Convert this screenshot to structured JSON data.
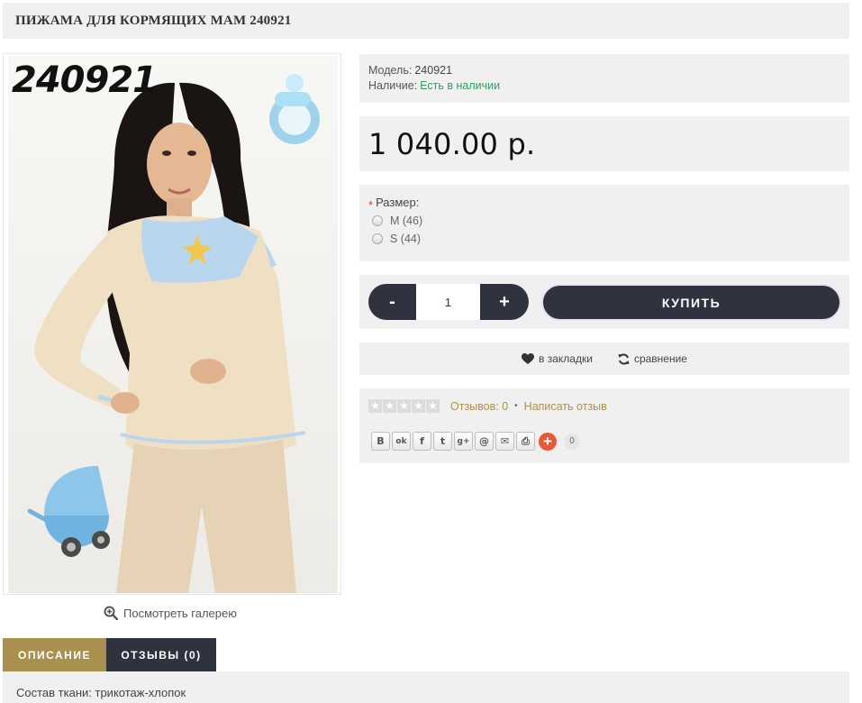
{
  "product": {
    "title": "ПИЖАМА ДЛЯ КОРМЯЩИХ МАМ 240921",
    "photo_code": "240921",
    "gallery_label": "Посмотреть галерею"
  },
  "info": {
    "model_label": "Модель:",
    "model_value": "240921",
    "availability_label": "Наличие:",
    "availability_value": "Есть в наличии"
  },
  "price": "1 040.00 р.",
  "options": {
    "required_mark": "*",
    "size_label": "Размер:",
    "sizes": [
      {
        "label": "M (46)",
        "selected": false
      },
      {
        "label": "S (44)",
        "selected": false
      }
    ]
  },
  "purchase": {
    "minus_label": "-",
    "plus_label": "+",
    "quantity": "1",
    "buy_label": "КУПИТЬ"
  },
  "links": {
    "wishlist_label": "в закладки",
    "compare_label": "сравнение"
  },
  "reviews": {
    "stars_filled": 0,
    "stars_total": 5,
    "count_label": "Отзывов: 0",
    "separator": "•",
    "write_label": "Написать отзыв"
  },
  "share": {
    "buttons": [
      {
        "name": "vk-icon",
        "glyph": "В"
      },
      {
        "name": "odnoklassniki-icon",
        "glyph": "ok"
      },
      {
        "name": "facebook-icon",
        "glyph": "f"
      },
      {
        "name": "twitter-icon",
        "glyph": "t"
      },
      {
        "name": "google-plus-icon",
        "glyph": "g+"
      },
      {
        "name": "mail-ru-icon",
        "glyph": "@"
      },
      {
        "name": "email-icon",
        "glyph": "✉"
      },
      {
        "name": "print-icon",
        "glyph": "⎙"
      }
    ],
    "more_glyph": "+",
    "count": "0"
  },
  "tabs": {
    "description": "ОПИСАНИЕ",
    "reviews": "ОТЗЫВЫ (0)"
  },
  "description_text": "Состав ткани: трикотаж-хлопок",
  "colors": {
    "accent_gold": "#a9904c",
    "dark_navy": "#2f3340",
    "in_stock_green": "#2e9e5f",
    "panel_gray": "#f0f0f0"
  }
}
